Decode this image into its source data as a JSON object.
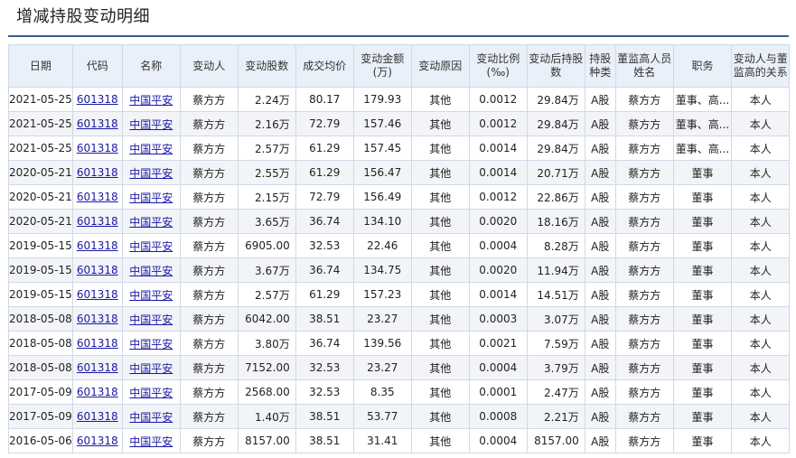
{
  "page_title": "增减持股变动明细",
  "colors": {
    "title_rule": "#3b5b93",
    "header_bg": "#eaf0f9",
    "border": "#d0d9e8",
    "alt_row_bg": "#f2f4f7",
    "link": "#1a1aa6"
  },
  "table": {
    "headers": [
      "日期",
      "代码",
      "名称",
      "变动人",
      "变动股数",
      "成交均价",
      "变动金额(万)",
      "变动原因",
      "变动比例(‰)",
      "变动后持股数",
      "持股种类",
      "董监高人员姓名",
      "职务",
      "变动人与董监高的关系"
    ],
    "rows": [
      [
        "2021-05-25",
        "601318",
        "中国平安",
        "蔡方方",
        "2.24万",
        "80.17",
        "179.93",
        "其他",
        "0.0012",
        "29.84万",
        "A股",
        "蔡方方",
        "董事、高...",
        "本人"
      ],
      [
        "2021-05-25",
        "601318",
        "中国平安",
        "蔡方方",
        "2.16万",
        "72.79",
        "157.46",
        "其他",
        "0.0012",
        "29.84万",
        "A股",
        "蔡方方",
        "董事、高...",
        "本人"
      ],
      [
        "2021-05-25",
        "601318",
        "中国平安",
        "蔡方方",
        "2.57万",
        "61.29",
        "157.45",
        "其他",
        "0.0014",
        "29.84万",
        "A股",
        "蔡方方",
        "董事、高...",
        "本人"
      ],
      [
        "2020-05-21",
        "601318",
        "中国平安",
        "蔡方方",
        "2.55万",
        "61.29",
        "156.47",
        "其他",
        "0.0014",
        "20.71万",
        "A股",
        "蔡方方",
        "董事",
        "本人"
      ],
      [
        "2020-05-21",
        "601318",
        "中国平安",
        "蔡方方",
        "2.15万",
        "72.79",
        "156.49",
        "其他",
        "0.0012",
        "22.86万",
        "A股",
        "蔡方方",
        "董事",
        "本人"
      ],
      [
        "2020-05-21",
        "601318",
        "中国平安",
        "蔡方方",
        "3.65万",
        "36.74",
        "134.10",
        "其他",
        "0.0020",
        "18.16万",
        "A股",
        "蔡方方",
        "董事",
        "本人"
      ],
      [
        "2019-05-15",
        "601318",
        "中国平安",
        "蔡方方",
        "6905.00",
        "32.53",
        "22.46",
        "其他",
        "0.0004",
        "8.28万",
        "A股",
        "蔡方方",
        "董事",
        "本人"
      ],
      [
        "2019-05-15",
        "601318",
        "中国平安",
        "蔡方方",
        "3.67万",
        "36.74",
        "134.75",
        "其他",
        "0.0020",
        "11.94万",
        "A股",
        "蔡方方",
        "董事",
        "本人"
      ],
      [
        "2019-05-15",
        "601318",
        "中国平安",
        "蔡方方",
        "2.57万",
        "61.29",
        "157.23",
        "其他",
        "0.0014",
        "14.51万",
        "A股",
        "蔡方方",
        "董事",
        "本人"
      ],
      [
        "2018-05-08",
        "601318",
        "中国平安",
        "蔡方方",
        "6042.00",
        "38.51",
        "23.27",
        "其他",
        "0.0003",
        "3.07万",
        "A股",
        "蔡方方",
        "董事",
        "本人"
      ],
      [
        "2018-05-08",
        "601318",
        "中国平安",
        "蔡方方",
        "3.80万",
        "36.74",
        "139.56",
        "其他",
        "0.0021",
        "7.59万",
        "A股",
        "蔡方方",
        "董事",
        "本人"
      ],
      [
        "2018-05-08",
        "601318",
        "中国平安",
        "蔡方方",
        "7152.00",
        "32.53",
        "23.27",
        "其他",
        "0.0004",
        "3.79万",
        "A股",
        "蔡方方",
        "董事",
        "本人"
      ],
      [
        "2017-05-09",
        "601318",
        "中国平安",
        "蔡方方",
        "2568.00",
        "32.53",
        "8.35",
        "其他",
        "0.0001",
        "2.47万",
        "A股",
        "蔡方方",
        "董事",
        "本人"
      ],
      [
        "2017-05-09",
        "601318",
        "中国平安",
        "蔡方方",
        "1.40万",
        "38.51",
        "53.77",
        "其他",
        "0.0008",
        "2.21万",
        "A股",
        "蔡方方",
        "董事",
        "本人"
      ],
      [
        "2016-05-06",
        "601318",
        "中国平安",
        "蔡方方",
        "8157.00",
        "38.51",
        "31.41",
        "其他",
        "0.0004",
        "8157.00",
        "A股",
        "蔡方方",
        "董事",
        "本人"
      ]
    ]
  }
}
